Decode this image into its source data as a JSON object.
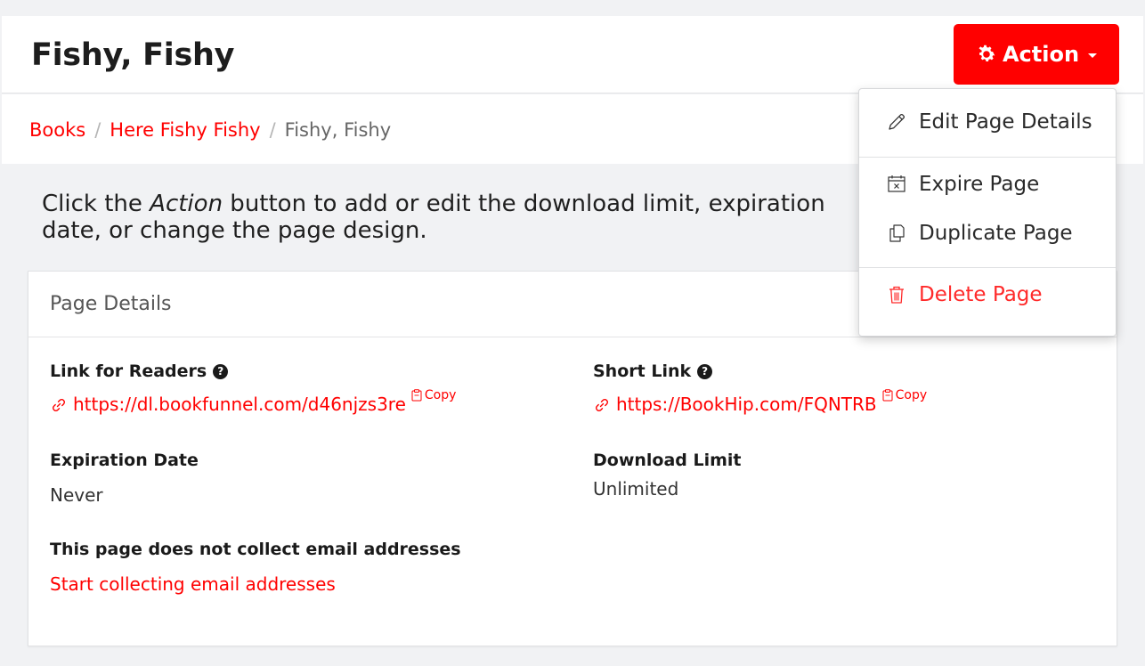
{
  "header": {
    "title": "Fishy, Fishy",
    "action_label": "Action"
  },
  "breadcrumb": {
    "items": [
      "Books",
      "Here Fishy Fishy",
      "Fishy, Fishy"
    ],
    "separator": "/"
  },
  "intro": {
    "before": "Click the ",
    "emphasis": "Action",
    "after": " button to add or edit the download limit, expiration date, or change the page design."
  },
  "card": {
    "title": "Page Details",
    "link_for_readers": {
      "label": "Link for Readers",
      "url": "https://dl.bookfunnel.com/d46njzs3re",
      "copy_label": "Copy"
    },
    "short_link": {
      "label": "Short Link",
      "url": "https://BookHip.com/FQNTRB",
      "copy_label": "Copy"
    },
    "expiration": {
      "label": "Expiration Date",
      "value": "Never"
    },
    "download_limit": {
      "label": "Download Limit",
      "value": "Unlimited"
    },
    "email": {
      "label": "This page does not collect email addresses",
      "link": "Start collecting email addresses"
    }
  },
  "dropdown": {
    "items": [
      {
        "label": "Edit Page Details",
        "icon": "pencil-icon"
      },
      {
        "label": "Expire Page",
        "icon": "calendar-x-icon"
      },
      {
        "label": "Duplicate Page",
        "icon": "copy-icon"
      },
      {
        "label": "Delete Page",
        "icon": "trash-icon"
      }
    ]
  },
  "colors": {
    "accent": "#ff0000",
    "danger": "#ff2a2a",
    "background": "#f1f2f4"
  }
}
